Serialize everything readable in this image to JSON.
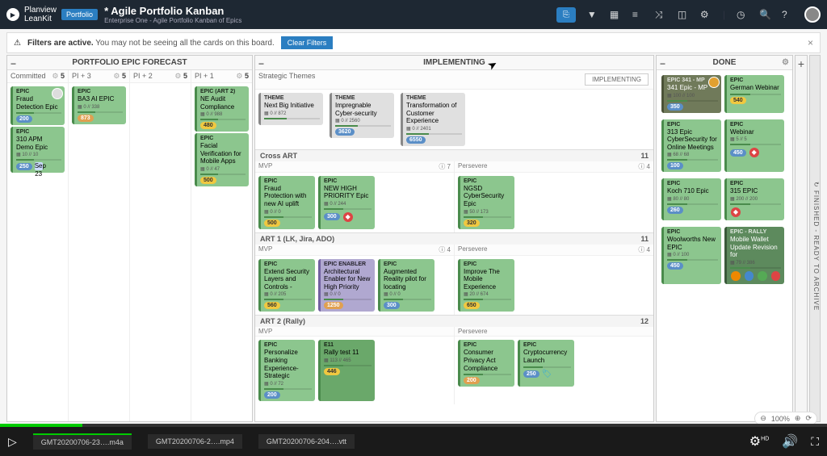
{
  "nav": {
    "brand1": "Planview",
    "brand2": "LeanKit",
    "tag": "Portfolio",
    "title": "* Agile Portfolio Kanban",
    "subtitle": "Enterprise One - Agile Portfolio Kanban of Epics"
  },
  "filter": {
    "prefix": "Filters are active.",
    "msg": "You may not be seeing all the cards on this board.",
    "clear": "Clear Filters"
  },
  "cols": {
    "forecast": "PORTFOLIO EPIC FORECAST",
    "implementing": "IMPLEMENTING",
    "done": "DONE",
    "rail": "FINISHED - READY TO ARCHIVE"
  },
  "forecast_sub": [
    {
      "label": "Committed",
      "n": "5"
    },
    {
      "label": "PI + 3",
      "n": "5"
    },
    {
      "label": "PI + 2",
      "n": "5"
    },
    {
      "label": "PI + 1",
      "n": "5"
    }
  ],
  "forecast_cards": {
    "committed": [
      {
        "type": "EPIC",
        "title": "Fraud Detection Epic",
        "pill": "200",
        "avatar": true
      },
      {
        "type": "EPIC",
        "title": "310 APM Demo Epic",
        "meta": "10 // 10",
        "pill": "250",
        "date": "Sep 23"
      }
    ],
    "pi3": [
      {
        "type": "EPIC",
        "title": "BA3 AI EPIC",
        "meta": "0 // 338",
        "pill": "873",
        "pillc": "orange"
      }
    ],
    "pi2": [],
    "pi1": [
      {
        "type": "EPIC (ART 2)",
        "title": "NE Audit Compliance",
        "meta": "0 // 988",
        "pill": "480",
        "pillc": "yellow"
      },
      {
        "type": "EPIC",
        "title": "Facial Verification for Mobile Apps",
        "meta": "0 // 47",
        "pill": "500",
        "pillc": "yellow"
      }
    ]
  },
  "impl": {
    "themes_label": "Strategic Themes",
    "tab": "IMPLEMENTING",
    "themes": [
      {
        "type": "THEME",
        "title": "Next Big Initiative",
        "meta": "0 // 872"
      },
      {
        "type": "THEME",
        "title": "Impregnable Cyber-security",
        "meta": "0 // 2560",
        "pill": "3620"
      },
      {
        "type": "THEME",
        "title": "Transformation of Customer Experience",
        "meta": "0 // 2401",
        "pill": "6550"
      }
    ],
    "swim": [
      {
        "name": "Cross ART",
        "n": "11",
        "sub": [
          {
            "h": "MVP",
            "info": "ⓘ 7",
            "cards": [
              {
                "type": "EPIC",
                "title": "Fraud Protection with new AI uplift",
                "meta": "0 // 0",
                "pill": "500",
                "pillc": "yellow"
              },
              {
                "type": "EPIC",
                "title": "NEW HIGH PRIORITY Epic",
                "meta": "0 // 244",
                "pill": "300",
                "pillc": "blue",
                "red": true
              }
            ]
          },
          {
            "h": "Persevere",
            "info": "ⓘ 4",
            "cards": [
              {
                "type": "EPIC",
                "title": "NGSD CyberSecurity Epic",
                "meta": "50 // 173",
                "pill": "320",
                "pillc": "yellow"
              }
            ]
          }
        ]
      },
      {
        "name": "ART 1 (LK, Jira, ADO)",
        "n": "11",
        "sub": [
          {
            "h": "MVP",
            "info": "ⓘ 4",
            "cards": [
              {
                "type": "EPIC",
                "title": "Extend Security Layers and Controls -",
                "meta": "0 // 205",
                "pill": "560",
                "pillc": "yellow"
              },
              {
                "type": "EPIC ENABLER",
                "kind": "enabler",
                "title": "Architectural Enabler for New High Priority",
                "meta": "0 // 0",
                "pill": "1250",
                "pillc": "orange"
              },
              {
                "type": "EPIC",
                "title": "Augmented Reality pilot for locating",
                "meta": "0 // 0",
                "pill": "300",
                "pillc": "blue"
              }
            ]
          },
          {
            "h": "Persevere",
            "info": "ⓘ 4",
            "cards": [
              {
                "type": "EPIC",
                "title": "Improve The Mobile Experience",
                "meta": "20 // 674",
                "pill": "650",
                "pillc": "yellow"
              }
            ]
          }
        ]
      },
      {
        "name": "ART 2 (Rally)",
        "n": "12",
        "sub": [
          {
            "h": "MVP",
            "info": "",
            "cards": [
              {
                "type": "EPIC",
                "title": "Personalize Banking Experience-Strategic",
                "meta": "0 // 72",
                "pill": "200",
                "pillc": "blue"
              },
              {
                "type": "E11",
                "kind": "e11",
                "title": "Rally test 11",
                "meta": "113 // 465",
                "pill": "446",
                "pillc": "yellow"
              }
            ]
          },
          {
            "h": "Persevere",
            "info": "",
            "cards": [
              {
                "type": "EPIC",
                "title": "Consumer Privacy Act Compliance",
                "pill": "200",
                "pillc": "orange"
              },
              {
                "type": "EPIC",
                "title": "Cryptocurrency Launch",
                "pill": "250",
                "pillc": "blue",
                "flag": true
              }
            ]
          }
        ]
      }
    ]
  },
  "done": [
    [
      {
        "type": "EPIC 341 - MP",
        "kind": "mp",
        "title": "341 Epic - MP",
        "meta": "100 // 100",
        "pill": "350",
        "gold": true
      },
      {
        "type": "EPIC",
        "title": "German Webinar",
        "pill": "540",
        "pillc": "yellow"
      }
    ],
    [
      {
        "type": "EPIC",
        "title": "313 Epic CyberSecurity for Online Meetings",
        "meta": "68 // 68",
        "pill": "100"
      },
      {
        "type": "EPIC",
        "title": "Webinar",
        "meta": "5 // 5",
        "pill": "450",
        "red": true
      }
    ],
    [
      {
        "type": "EPIC",
        "title": "Koch 710 Epic",
        "meta": "80 // 80",
        "pill": "260"
      },
      {
        "type": "EPIC",
        "title": "315 EPIC",
        "meta": "200 // 200",
        "red": true
      }
    ],
    [
      {
        "type": "EPIC",
        "title": "Woolworths New EPIC",
        "meta": "0 // 100",
        "pill": "450"
      },
      {
        "type": "EPIC - RALLY",
        "kind": "rally",
        "title": "Mobile Wallet Update Revision for",
        "meta": "79 // 386",
        "icons": true
      }
    ]
  ],
  "zoom": "100%",
  "video": {
    "tabs": [
      "GMT20200706-23….m4a",
      "GMT20200706-2….mp4",
      "GMT20200706-204….vtt"
    ]
  }
}
